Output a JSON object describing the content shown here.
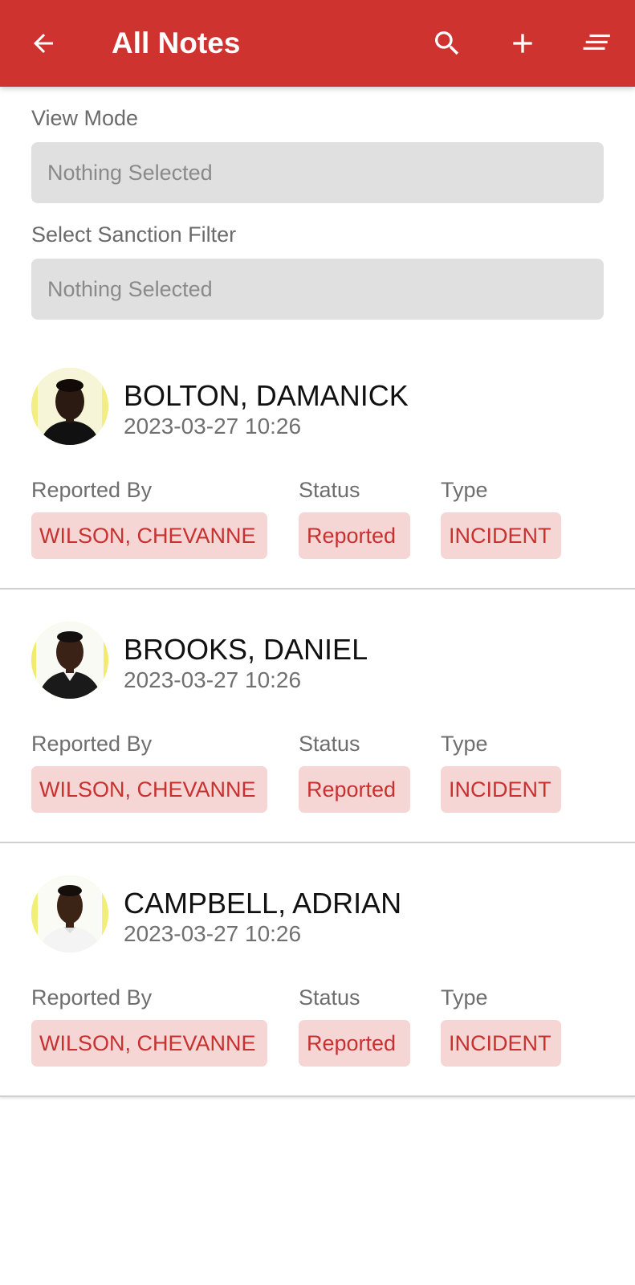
{
  "app_bar": {
    "title": "All Notes",
    "back_icon": "arrow-back-icon",
    "search_icon": "search-icon",
    "add_icon": "plus-icon",
    "sort_icon": "sort-icon",
    "color": "#cf3330"
  },
  "filters": {
    "view_mode": {
      "label": "View Mode",
      "value": "Nothing Selected"
    },
    "sanction_filter": {
      "label": "Select Sanction Filter",
      "value": "Nothing Selected"
    }
  },
  "notes": [
    {
      "name": "BOLTON, DAMANICK",
      "date": "2023-03-27 10:26",
      "reported_by_label": "Reported By",
      "reported_by": "WILSON, CHEVANNE",
      "status_label": "Status",
      "status": "Reported",
      "type_label": "Type",
      "type": "INCIDENT"
    },
    {
      "name": "BROOKS, DANIEL",
      "date": "2023-03-27 10:26",
      "reported_by_label": "Reported By",
      "reported_by": "WILSON, CHEVANNE",
      "status_label": "Status",
      "status": "Reported",
      "type_label": "Type",
      "type": "INCIDENT"
    },
    {
      "name": "CAMPBELL, ADRIAN",
      "date": "2023-03-27 10:26",
      "reported_by_label": "Reported By",
      "reported_by": "WILSON, CHEVANNE",
      "status_label": "Status",
      "status": "Reported",
      "type_label": "Type",
      "type": "INCIDENT"
    }
  ],
  "colors": {
    "chip_background": "#f5d6d5",
    "chip_text": "#c7312f",
    "select_background": "#e0e0e0"
  }
}
